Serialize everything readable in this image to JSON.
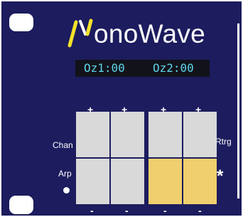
{
  "app": {
    "title": "MonoWave",
    "title_rest": "onoWave",
    "logo_letter": "M"
  },
  "display": {
    "osc1": "Oz1:00",
    "osc2": "Oz2:00"
  },
  "controls": {
    "plus": "+",
    "minus": "-",
    "left_top_label": "Chan",
    "left_bottom_label": "Arp",
    "right_top_label": "Rtrg",
    "right_bottom_label": "*"
  },
  "colors": {
    "background": "#1c1c5e",
    "pad_off": "#d9d9d9",
    "pad_on": "#f0cf6e",
    "logo_accent": "#f3e22a",
    "display_text": "#5ed6ea"
  },
  "pads": [
    {
      "row": 1,
      "col": 1,
      "state": "off"
    },
    {
      "row": 1,
      "col": 2,
      "state": "off"
    },
    {
      "row": 1,
      "col": 3,
      "state": "off"
    },
    {
      "row": 1,
      "col": 4,
      "state": "off"
    },
    {
      "row": 2,
      "col": 1,
      "state": "off"
    },
    {
      "row": 2,
      "col": 2,
      "state": "off"
    },
    {
      "row": 2,
      "col": 3,
      "state": "on"
    },
    {
      "row": 2,
      "col": 4,
      "state": "on"
    }
  ]
}
